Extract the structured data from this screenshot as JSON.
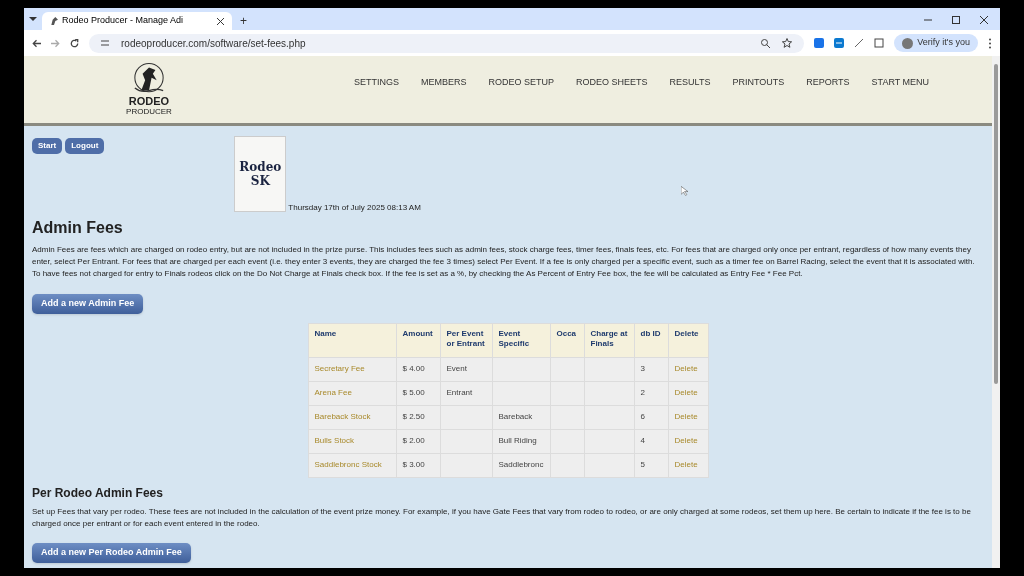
{
  "browser": {
    "tab_title": "Rodeo Producer - Manage Adi",
    "new_tab": "+",
    "url": "rodeoproducer.com/software/set-fees.php",
    "profile_button": "Verify it's you"
  },
  "site": {
    "logo_text": "RODEO",
    "logo_subtext": "PRODUCER",
    "nav": [
      "SETTINGS",
      "MEMBERS",
      "RODEO SETUP",
      "RODEO SHEETS",
      "RESULTS",
      "PRINTOUTS",
      "REPORTS",
      "START MENU"
    ]
  },
  "session_buttons": [
    "Start",
    "Logout"
  ],
  "rodeo_logo": {
    "line_1": "Rodeo",
    "line_2": "SK"
  },
  "date": "Thursday 17th of July 2025 08:13 AM",
  "admin_fees": {
    "title": "Admin Fees",
    "description": "Admin Fees are fees which are charged on rodeo entry, but are not included in the prize purse. This includes fees such as admin fees, stock charge fees, timer fees, finals fees, etc. For fees that are charged only once per entrant, regardless of how many events they enter, select Per Entrant. For fees that are charged per each event (i.e. they enter 3 events, they are charged the fee 3 times) select Per Event. If a fee is only charged per a specific event, such as a timer fee on Barrel Racing, select the event that it is associated with. To have fees not charged for entry to Finals rodeos click on the Do Not Charge at Finals check box. If the fee is set as a %, by checking the As Percent of Entry Fee box, the fee will be calculated as Entry Fee * Fee Pct.",
    "add_button": "Add a new Admin Fee",
    "table": {
      "columns": [
        "Name",
        "Amount",
        "Per Event or Entrant",
        "Event Specific",
        "Occa",
        "Charge at Finals",
        "db ID",
        "Delete"
      ],
      "rows": [
        {
          "name": "Secretary Fee",
          "amount": "$ 4.00",
          "per": "Event",
          "event": "",
          "occa": "",
          "finals": "",
          "db_id": "3",
          "delete": "Delete"
        },
        {
          "name": "Arena Fee",
          "amount": "$ 5.00",
          "per": "Entrant",
          "event": "",
          "occa": "",
          "finals": "",
          "db_id": "2",
          "delete": "Delete"
        },
        {
          "name": "Bareback Stock",
          "amount": "$ 2.50",
          "per": "",
          "event": "Bareback",
          "occa": "",
          "finals": "",
          "db_id": "6",
          "delete": "Delete"
        },
        {
          "name": "Bulls Stock",
          "amount": "$ 2.00",
          "per": "",
          "event": "Bull Riding",
          "occa": "",
          "finals": "",
          "db_id": "4",
          "delete": "Delete"
        },
        {
          "name": "Saddlebronc Stock",
          "amount": "$ 3.00",
          "per": "",
          "event": "Saddlebronc",
          "occa": "",
          "finals": "",
          "db_id": "5",
          "delete": "Delete"
        }
      ]
    }
  },
  "per_rodeo_fees": {
    "title": "Per Rodeo Admin Fees",
    "description": "Set up Fees that vary per rodeo. These fees are not included in the calculation of the event prize money. For example, if you have Gate Fees that vary from rodeo to rodeo, or are only charged at some rodeos, set them up here. Be certain to indicate if the fee is to be charged once per entrant or for each event entered in the rodeo.",
    "add_button": "Add a new Per Rodeo Admin Fee"
  }
}
